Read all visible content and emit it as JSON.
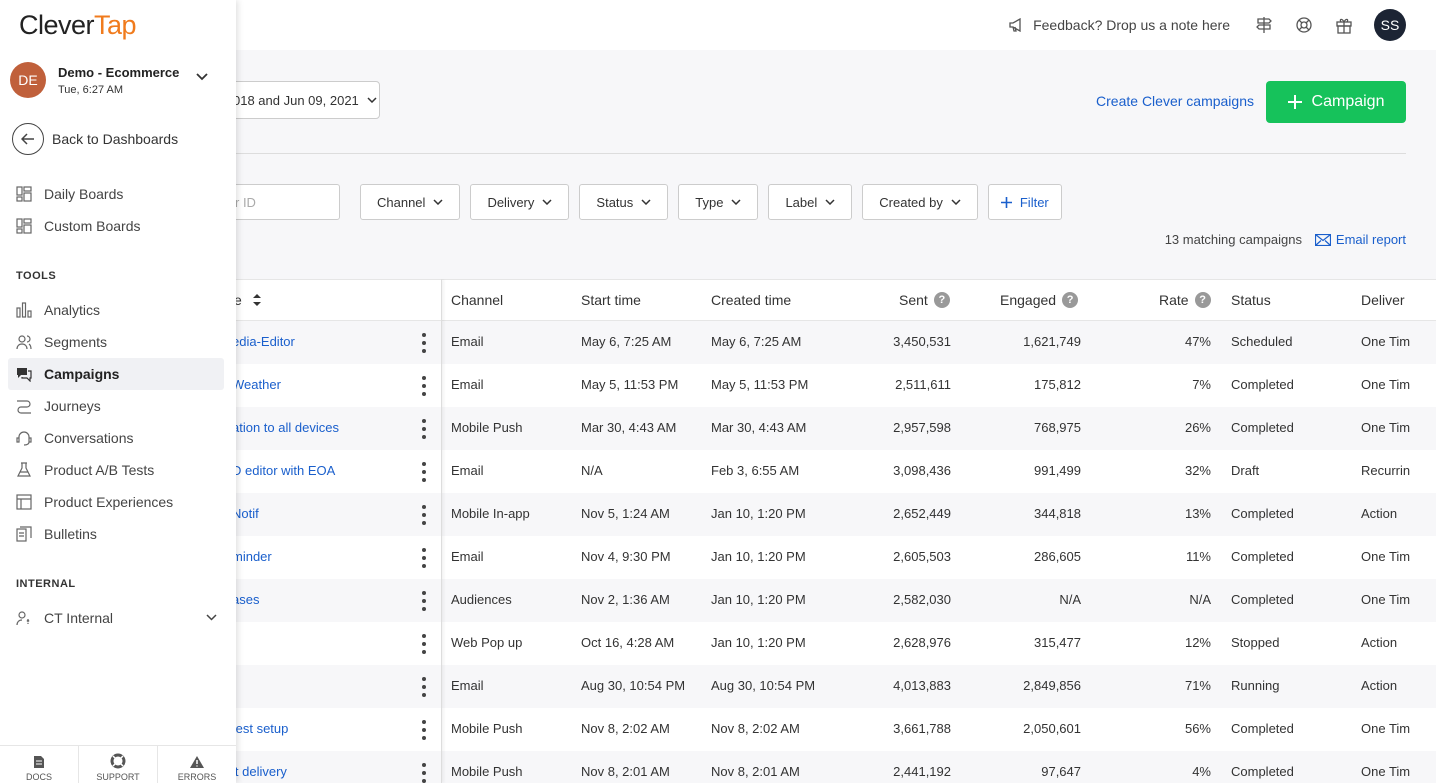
{
  "header": {
    "feedback": "Feedback? Drop us a note here",
    "user_initials": "SS"
  },
  "sidebar": {
    "logo_part1": "Clever",
    "logo_part2": "Tap",
    "account_initials": "DE",
    "account_name": "Demo - Ecommerce",
    "account_time": "Tue, 6:27 AM",
    "back": "Back to Dashboards",
    "boards": [
      {
        "label": "Daily Boards",
        "icon": "boards-icon"
      },
      {
        "label": "Custom Boards",
        "icon": "boards-icon"
      }
    ],
    "tools_title": "TOOLS",
    "tools": [
      {
        "label": "Analytics",
        "icon": "analytics-icon"
      },
      {
        "label": "Segments",
        "icon": "segments-icon"
      },
      {
        "label": "Campaigns",
        "icon": "campaigns-icon",
        "active": true
      },
      {
        "label": "Journeys",
        "icon": "journeys-icon"
      },
      {
        "label": "Conversations",
        "icon": "conversations-icon"
      },
      {
        "label": "Product A/B Tests",
        "icon": "flask-icon"
      },
      {
        "label": "Product Experiences",
        "icon": "experiences-icon"
      },
      {
        "label": "Bulletins",
        "icon": "bulletins-icon"
      }
    ],
    "internal_title": "INTERNAL",
    "internal_item": "CT Internal",
    "bottom": [
      "DOCS",
      "SUPPORT",
      "ERRORS"
    ]
  },
  "toolbar": {
    "date_range": "018 and Jun 09, 2021",
    "create_link": "Create Clever campaigns",
    "campaign_button": "Campaign",
    "search_placeholder": "r ID",
    "filters": [
      "Channel",
      "Delivery",
      "Status",
      "Type",
      "Label",
      "Created by"
    ],
    "filter_button": "Filter",
    "matching": "13 matching campaigns",
    "email_report": "Email report"
  },
  "table": {
    "name_header": "e",
    "headers": {
      "channel": "Channel",
      "start": "Start time",
      "created": "Created time",
      "sent": "Sent",
      "engaged": "Engaged",
      "rate": "Rate",
      "status": "Status",
      "delivery": "Deliver"
    },
    "rows": [
      {
        "name": "edia-Editor",
        "channel": "Email",
        "start": "May 6, 7:25 AM",
        "created": "May 6, 7:25 AM",
        "sent": "3,450,531",
        "engaged": "1,621,749",
        "rate": "47%",
        "status": "Scheduled",
        "delivery": "One Tim"
      },
      {
        "name": "Weather",
        "channel": "Email",
        "start": "May 5, 11:53 PM",
        "created": "May 5, 11:53 PM",
        "sent": "2,511,611",
        "engaged": "175,812",
        "rate": "7%",
        "status": "Completed",
        "delivery": "One Tim"
      },
      {
        "name": "ation to all devices",
        "channel": "Mobile Push",
        "start": "Mar 30, 4:43 AM",
        "created": "Mar 30, 4:43 AM",
        "sent": "2,957,598",
        "engaged": "768,975",
        "rate": "26%",
        "status": "Completed",
        "delivery": "One Tim"
      },
      {
        "name": "D editor with EOA",
        "channel": "Email",
        "start": "N/A",
        "created": "Feb 3, 6:55 AM",
        "sent": "3,098,436",
        "engaged": "991,499",
        "rate": "32%",
        "status": "Draft",
        "delivery": "Recurrin"
      },
      {
        "name": "Notif",
        "channel": "Mobile In-app",
        "start": "Nov 5, 1:24 AM",
        "created": "Jan 10, 1:20 PM",
        "sent": "2,652,449",
        "engaged": "344,818",
        "rate": "13%",
        "status": "Completed",
        "delivery": "Action"
      },
      {
        "name": "minder",
        "channel": "Email",
        "start": "Nov 4, 9:30 PM",
        "created": "Jan 10, 1:20 PM",
        "sent": "2,605,503",
        "engaged": "286,605",
        "rate": "11%",
        "status": "Completed",
        "delivery": "One Tim"
      },
      {
        "name": "ases",
        "channel": "Audiences",
        "start": "Nov 2, 1:36 AM",
        "created": "Jan 10, 1:20 PM",
        "sent": "2,582,030",
        "engaged": "N/A",
        "rate": "N/A",
        "status": "Completed",
        "delivery": "One Tim"
      },
      {
        "name": "",
        "channel": "Web Pop up",
        "start": "Oct 16, 4:28 AM",
        "created": "Jan 10, 1:20 PM",
        "sent": "2,628,976",
        "engaged": "315,477",
        "rate": "12%",
        "status": "Stopped",
        "delivery": "Action"
      },
      {
        "name": "",
        "channel": "Email",
        "start": "Aug 30, 10:54 PM",
        "created": "Aug 30, 10:54 PM",
        "sent": "4,013,883",
        "engaged": "2,849,856",
        "rate": "71%",
        "status": "Running",
        "delivery": "Action"
      },
      {
        "name": "test setup",
        "channel": "Mobile Push",
        "start": "Nov 8, 2:02 AM",
        "created": "Nov 8, 2:02 AM",
        "sent": "3,661,788",
        "engaged": "2,050,601",
        "rate": "56%",
        "status": "Completed",
        "delivery": "One Tim"
      },
      {
        "name": "it delivery",
        "channel": "Mobile Push",
        "start": "Nov 8, 2:01 AM",
        "created": "Nov 8, 2:01 AM",
        "sent": "2,441,192",
        "engaged": "97,647",
        "rate": "4%",
        "status": "Completed",
        "delivery": "One Tim"
      }
    ]
  }
}
